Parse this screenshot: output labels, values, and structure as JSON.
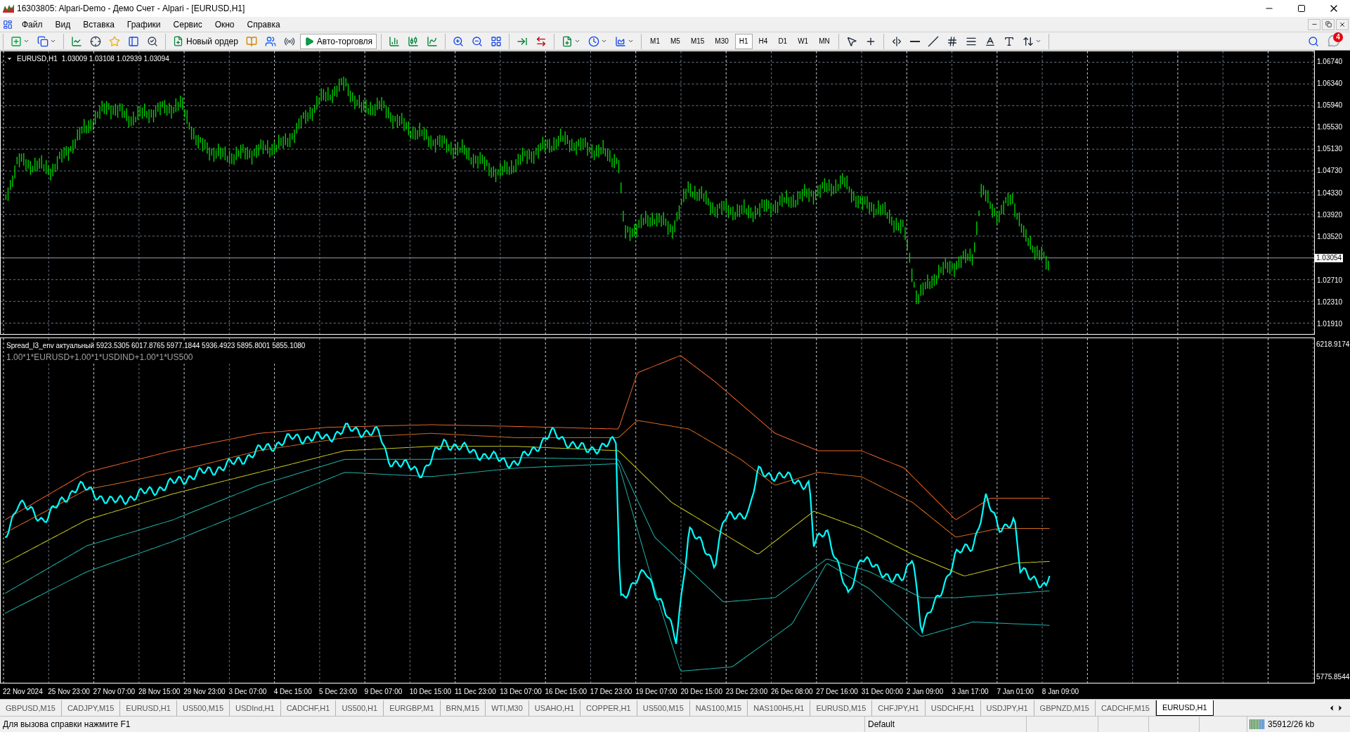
{
  "window": {
    "title": "16303805: Alpari-Demo - Демо Счет - Alpari - [EURUSD,H1]"
  },
  "menu": [
    "Файл",
    "Вид",
    "Вставка",
    "Графики",
    "Сервис",
    "Окно",
    "Справка"
  ],
  "toolbar": {
    "groups": [
      [
        {
          "kind": "dropdown"
        },
        {
          "kind": "dropdown"
        }
      ],
      [
        {
          "kind": "icon"
        },
        {
          "kind": "icon"
        },
        {
          "kind": "icon"
        },
        {
          "kind": "icon"
        },
        {
          "kind": "icon"
        }
      ],
      [
        {
          "kind": "button",
          "label": "Новый ордер"
        },
        {
          "kind": "icon"
        },
        {
          "kind": "icon"
        },
        {
          "kind": "icon"
        },
        {
          "kind": "toggle",
          "label": "Авто-торговля"
        }
      ],
      [
        {
          "kind": "icon"
        },
        {
          "kind": "icon"
        },
        {
          "kind": "icon"
        }
      ],
      [
        {
          "kind": "icon"
        },
        {
          "kind": "icon"
        },
        {
          "kind": "icon"
        }
      ],
      [
        {
          "kind": "icon"
        },
        {
          "kind": "icon"
        }
      ],
      [
        {
          "kind": "dropdown"
        },
        {
          "kind": "dropdown"
        },
        {
          "kind": "dropdown"
        }
      ],
      [
        {
          "kind": "timeframe",
          "label": "M1",
          "selected": false
        },
        {
          "kind": "timeframe",
          "label": "M5",
          "selected": false
        },
        {
          "kind": "timeframe",
          "label": "M15",
          "selected": false
        },
        {
          "kind": "timeframe",
          "label": "M30",
          "selected": false
        },
        {
          "kind": "timeframe",
          "label": "H1",
          "selected": true
        },
        {
          "kind": "timeframe",
          "label": "H4",
          "selected": false
        },
        {
          "kind": "timeframe",
          "label": "D1",
          "selected": false
        },
        {
          "kind": "timeframe",
          "label": "W1",
          "selected": false
        },
        {
          "kind": "timeframe",
          "label": "MN",
          "selected": false
        }
      ],
      [
        {
          "kind": "icon"
        },
        {
          "kind": "icon"
        }
      ],
      [
        {
          "kind": "icon"
        },
        {
          "kind": "icon"
        },
        {
          "kind": "icon"
        },
        {
          "kind": "icon"
        },
        {
          "kind": "icon"
        },
        {
          "kind": "icon"
        },
        {
          "kind": "icon"
        },
        {
          "kind": "dropdown"
        }
      ]
    ]
  },
  "notifications": {
    "count": "4"
  },
  "chart": {
    "symbol": "EURUSD,H1",
    "ohlc": "1.03009 1.03108 1.02939 1.03094",
    "price_labels": [
      {
        "kind": "tick",
        "text": "1.06740"
      },
      {
        "kind": "tick",
        "text": "1.06340"
      },
      {
        "kind": "tick",
        "text": "1.05940"
      },
      {
        "kind": "tick",
        "text": "1.05530"
      },
      {
        "kind": "tick",
        "text": "1.05130"
      },
      {
        "kind": "tick",
        "text": "1.04730"
      },
      {
        "kind": "tick",
        "text": "1.04330"
      },
      {
        "kind": "tick",
        "text": "1.03920"
      },
      {
        "kind": "tick",
        "text": "1.03520"
      },
      {
        "kind": "current",
        "text": "1.03054"
      },
      {
        "kind": "tick",
        "text": "1.02710"
      },
      {
        "kind": "tick",
        "text": "1.02310"
      },
      {
        "kind": "tick",
        "text": "1.01910"
      }
    ]
  },
  "indicator": {
    "title": "Spread_I3_env актуальный 5923.5305 6017.8765 5977.1844 5936.4923 5895.8001 5855.1080",
    "formula": "1.00*1*EURUSD+1.00*1*USDIND+1.00*1*US500",
    "axis_labels": [
      "6218.9174",
      "5775.8544"
    ]
  },
  "time_axis": [
    "22 Nov 2024",
    "25 Nov 23:00",
    "27 Nov 07:00",
    "28 Nov 15:00",
    "29 Nov 23:00",
    "3 Dec 07:00",
    "4 Dec 15:00",
    "5 Dec 23:00",
    "9 Dec 07:00",
    "10 Dec 15:00",
    "11 Dec 23:00",
    "13 Dec 07:00",
    "16 Dec 15:00",
    "17 Dec 23:00",
    "19 Dec 07:00",
    "20 Dec 15:00",
    "23 Dec 23:00",
    "26 Dec 08:00",
    "27 Dec 16:00",
    "31 Dec 00:00",
    "2 Jan 09:00",
    "3 Jan 17:00",
    "7 Jan 01:00",
    "8 Jan 09:00"
  ],
  "chart_tabs": [
    {
      "label": "GBPUSD,M15",
      "selected": false
    },
    {
      "label": "CADJPY,M15",
      "selected": false
    },
    {
      "label": "EURUSD,H1",
      "selected": false
    },
    {
      "label": "US500,M15",
      "selected": false
    },
    {
      "label": "USDInd,H1",
      "selected": false
    },
    {
      "label": "CADCHF,H1",
      "selected": false
    },
    {
      "label": "US500,H1",
      "selected": false
    },
    {
      "label": "EURGBP,M1",
      "selected": false
    },
    {
      "label": "BRN,M15",
      "selected": false
    },
    {
      "label": "WTI,M30",
      "selected": false
    },
    {
      "label": "USAHO,H1",
      "selected": false
    },
    {
      "label": "COPPER,H1",
      "selected": false
    },
    {
      "label": "US500,M15",
      "selected": false
    },
    {
      "label": "NAS100,M15",
      "selected": false
    },
    {
      "label": "NAS100H5,H1",
      "selected": false
    },
    {
      "label": "EURUSD,M15",
      "selected": false
    },
    {
      "label": "CHFJPY,H1",
      "selected": false
    },
    {
      "label": "USDCHF,H1",
      "selected": false
    },
    {
      "label": "USDJPY,H1",
      "selected": false
    },
    {
      "label": "GBPNZD,M15",
      "selected": false
    },
    {
      "label": "CADCHF,M15",
      "selected": false
    },
    {
      "label": "EURUSD,H1",
      "selected": true
    }
  ],
  "status_bar": {
    "help": "Для вызова справки нажмите F1",
    "profile": "Default",
    "traffic": "35912/26 kb"
  }
}
